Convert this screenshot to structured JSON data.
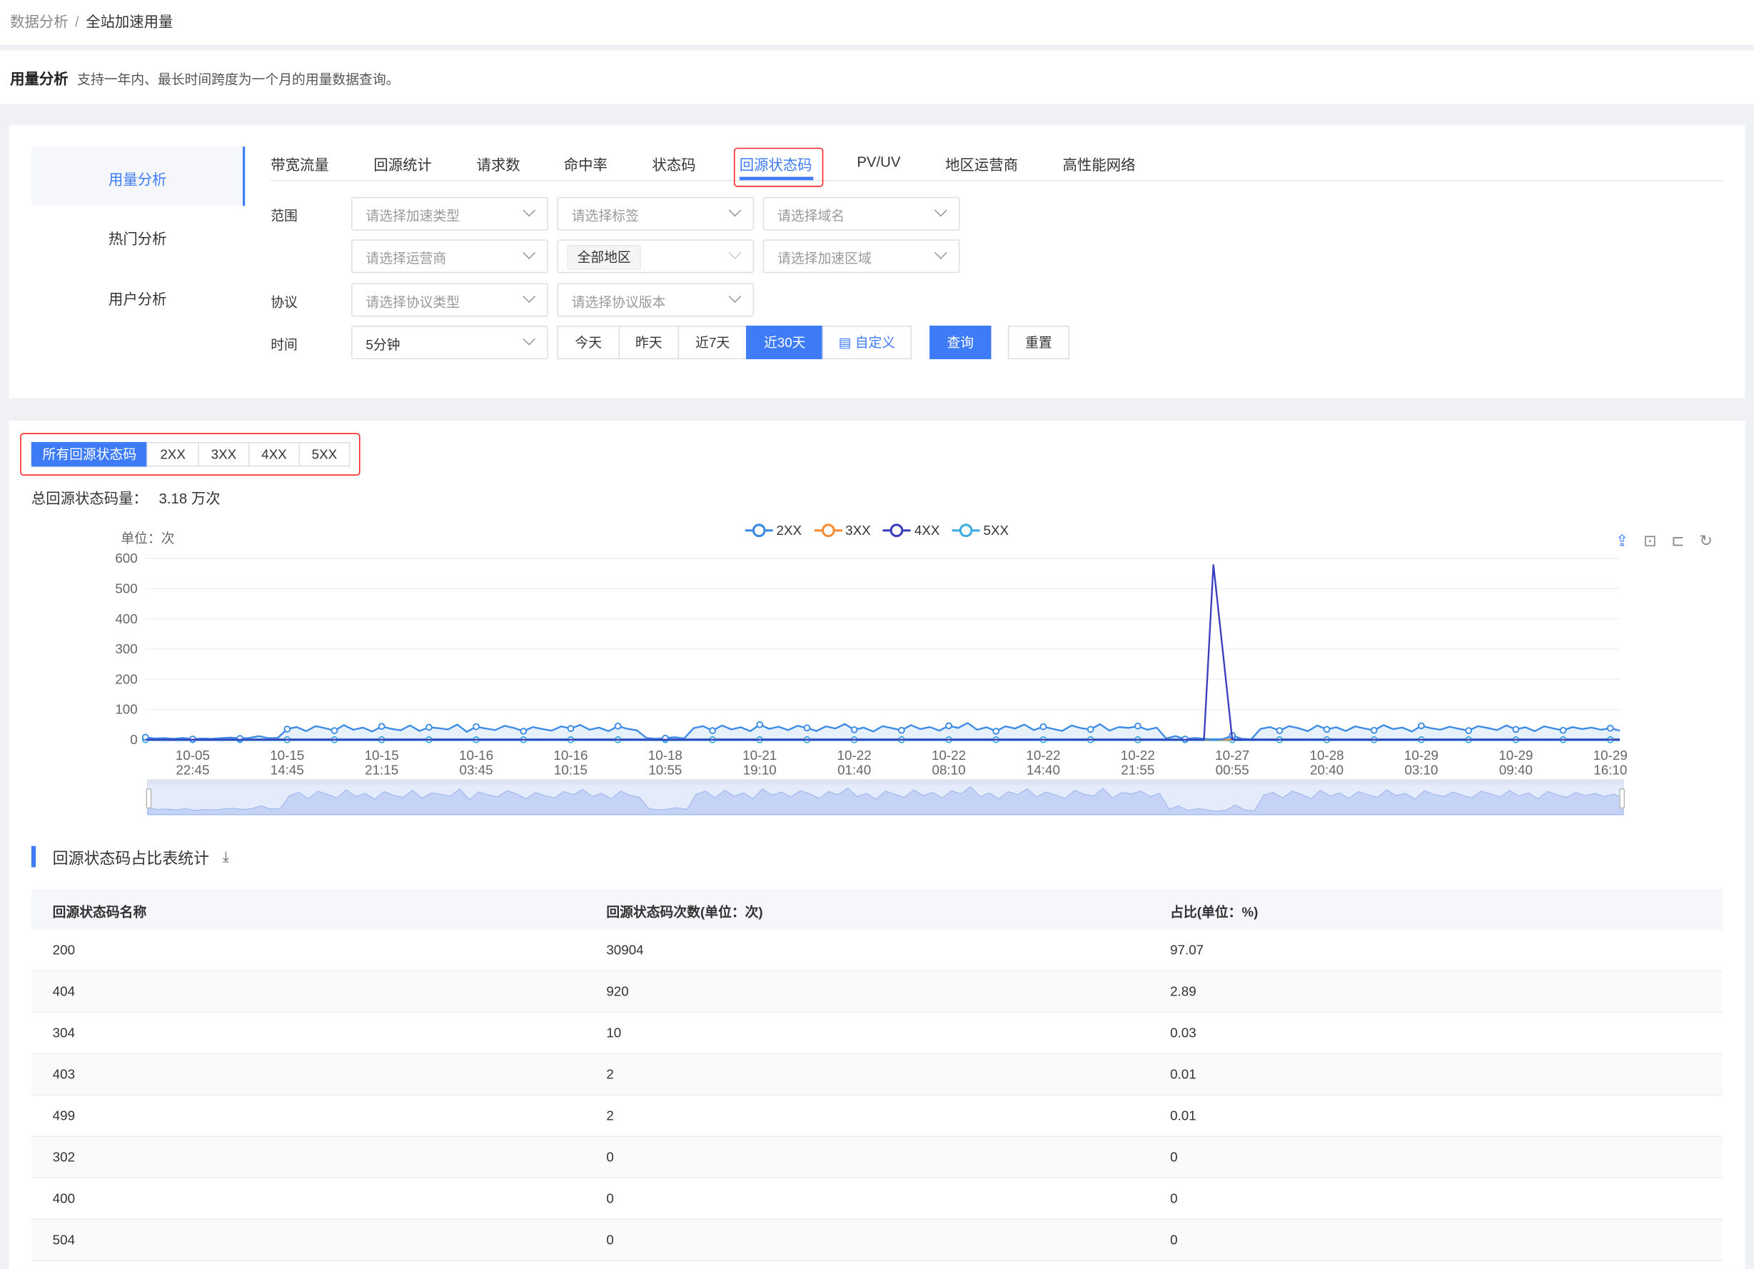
{
  "breadcrumb": {
    "parent": "数据分析",
    "separator": "/",
    "current": "全站加速用量"
  },
  "header": {
    "title": "用量分析",
    "description": "支持一年内、最长时间跨度为一个月的用量数据查询。"
  },
  "sidebar": {
    "items": [
      {
        "label": "用量分析",
        "active": true
      },
      {
        "label": "热门分析"
      },
      {
        "label": "用户分析"
      }
    ]
  },
  "tabs": [
    {
      "label": "带宽流量"
    },
    {
      "label": "回源统计"
    },
    {
      "label": "请求数"
    },
    {
      "label": "命中率"
    },
    {
      "label": "状态码"
    },
    {
      "label": "回源状态码",
      "active": true
    },
    {
      "label": "PV/UV"
    },
    {
      "label": "地区运营商"
    },
    {
      "label": "高性能网络"
    }
  ],
  "filters": {
    "scope_label": "范围",
    "protocol_label": "协议",
    "time_label": "时间",
    "accel_type": "请选择加速类型",
    "tag": "请选择标签",
    "domain": "请选择域名",
    "isp": "请选择运营商",
    "region": "全部地区",
    "accel_region": "请选择加速区域",
    "protocol_type": "请选择协议类型",
    "protocol_version": "请选择协议版本",
    "granularity": "5分钟",
    "time_ranges": [
      {
        "label": "今天"
      },
      {
        "label": "昨天"
      },
      {
        "label": "近7天"
      },
      {
        "label": "近30天",
        "active": true
      },
      {
        "label": "自定义"
      }
    ],
    "query": "查询",
    "reset": "重置"
  },
  "status_filter": [
    {
      "label": "所有回源状态码",
      "active": true
    },
    {
      "label": "2XX"
    },
    {
      "label": "3XX"
    },
    {
      "label": "4XX"
    },
    {
      "label": "5XX"
    }
  ],
  "summary": {
    "label": "总回源状态码量：",
    "value": "3.18 万次"
  },
  "toolbox": [
    "share-icon",
    "zoom-icon",
    "zoom-back-icon",
    "restore-icon"
  ],
  "colors": {
    "accent": "#3d7bf7",
    "2XX": "#3b8ae6",
    "3XX": "#fa8c35",
    "4XX": "#3a3fbf",
    "5XX": "#3eaee0",
    "highlight_box": "#ff2222"
  },
  "chart_data": {
    "type": "line",
    "unit_label": "单位：次",
    "ylim": [
      0,
      600
    ],
    "yticks": [
      0,
      100,
      200,
      300,
      400,
      500,
      600
    ],
    "grid": true,
    "legend_position": "top-center",
    "x_tick_labels": [
      [
        "10-05",
        "22:45"
      ],
      [
        "10-15",
        "14:45"
      ],
      [
        "10-15",
        "21:15"
      ],
      [
        "10-16",
        "03:45"
      ],
      [
        "10-16",
        "10:15"
      ],
      [
        "10-18",
        "10:55"
      ],
      [
        "10-21",
        "19:10"
      ],
      [
        "10-22",
        "01:40"
      ],
      [
        "10-22",
        "08:10"
      ],
      [
        "10-22",
        "14:40"
      ],
      [
        "10-22",
        "21:55"
      ],
      [
        "10-27",
        "00:55"
      ],
      [
        "10-28",
        "20:40"
      ],
      [
        "10-29",
        "03:10"
      ],
      [
        "10-29",
        "09:40"
      ],
      [
        "10-29",
        "16:10"
      ]
    ],
    "series": [
      {
        "name": "2XX",
        "values": [
          8,
          4,
          5,
          3,
          6,
          2,
          4,
          3,
          5,
          7,
          4,
          6,
          12,
          5,
          6,
          35,
          42,
          28,
          45,
          38,
          30,
          48,
          33,
          40,
          27,
          44,
          36,
          31,
          47,
          29,
          41,
          38,
          34,
          50,
          26,
          43,
          37,
          32,
          46,
          39,
          28,
          42,
          35,
          30,
          44,
          37,
          49,
          33,
          40,
          28,
          45,
          36,
          31,
          6,
          3,
          5,
          8,
          4,
          38,
          45,
          30,
          47,
          34,
          41,
          28,
          50,
          36,
          43,
          32,
          46,
          39,
          29,
          44,
          37,
          52,
          33,
          40,
          27,
          45,
          38,
          31,
          48,
          35,
          42,
          30,
          46,
          39,
          55,
          33,
          41,
          28,
          44,
          37,
          50,
          32,
          43,
          36,
          29,
          47,
          38,
          34,
          51,
          30,
          42,
          39,
          45,
          33,
          40,
          4,
          12,
          2,
          6,
          3,
          0,
          2,
          14,
          3,
          1,
          36,
          42,
          30,
          45,
          38,
          28,
          47,
          34,
          41,
          29,
          44,
          37,
          31,
          48,
          35,
          40,
          27,
          46,
          38,
          33,
          43,
          36,
          30,
          45,
          39,
          32,
          47,
          34,
          41,
          28,
          44,
          37,
          31,
          42,
          35,
          40,
          33,
          38,
          30
        ]
      },
      {
        "name": "3XX",
        "values": [
          0
        ]
      },
      {
        "name": "4XX",
        "values": [
          0,
          0,
          0,
          0,
          0,
          0,
          0,
          0,
          0,
          0,
          0,
          0,
          0,
          0,
          0,
          0,
          0,
          0,
          0,
          0,
          0,
          0,
          0,
          0,
          0,
          0,
          0,
          0,
          0,
          0,
          0,
          0,
          0,
          0,
          0,
          0,
          0,
          0,
          0,
          0,
          0,
          0,
          0,
          0,
          0,
          0,
          0,
          0,
          0,
          0,
          0,
          0,
          0,
          0,
          0,
          0,
          0,
          0,
          0,
          0,
          0,
          0,
          0,
          0,
          0,
          0,
          0,
          0,
          0,
          0,
          0,
          0,
          0,
          0,
          0,
          0,
          0,
          0,
          0,
          0,
          0,
          0,
          0,
          0,
          0,
          0,
          0,
          0,
          0,
          0,
          0,
          0,
          0,
          0,
          0,
          0,
          0,
          0,
          0,
          0,
          0,
          0,
          0,
          0,
          0,
          0,
          0,
          0,
          0,
          0,
          0,
          0,
          0,
          580,
          290,
          0,
          0,
          0,
          0,
          0,
          0,
          0,
          0,
          0,
          0,
          0,
          0,
          0,
          0,
          0,
          0,
          0,
          0,
          0,
          0,
          0,
          0,
          0,
          0,
          0,
          0,
          0,
          0,
          0,
          0,
          0,
          0,
          0,
          0,
          0,
          0,
          0,
          0,
          0,
          0,
          0,
          0
        ]
      },
      {
        "name": "5XX",
        "values": [
          0
        ]
      }
    ]
  },
  "table": {
    "title": "回源状态码占比表统计",
    "columns": [
      "回源状态码名称",
      "回源状态码次数(单位：次)",
      "占比(单位：%)"
    ],
    "rows": [
      [
        "200",
        "30904",
        "97.07"
      ],
      [
        "404",
        "920",
        "2.89"
      ],
      [
        "304",
        "10",
        "0.03"
      ],
      [
        "403",
        "2",
        "0.01"
      ],
      [
        "499",
        "2",
        "0.01"
      ],
      [
        "302",
        "0",
        "0"
      ],
      [
        "400",
        "0",
        "0"
      ],
      [
        "504",
        "0",
        "0"
      ]
    ]
  }
}
